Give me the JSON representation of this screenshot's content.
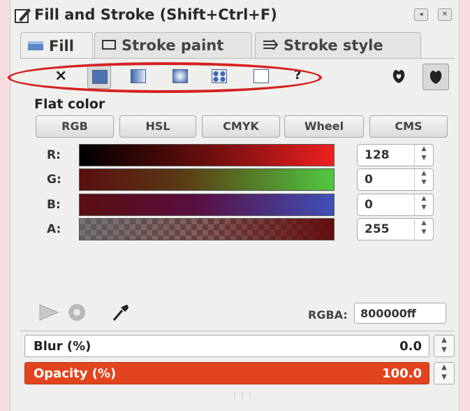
{
  "title": "Fill and Stroke (Shift+Ctrl+F)",
  "tabs": [
    {
      "label": "Fill"
    },
    {
      "label": "Stroke paint"
    },
    {
      "label": "Stroke style"
    }
  ],
  "paint_types": [
    {
      "name": "no-paint",
      "glyph": "×"
    },
    {
      "name": "flat-color",
      "selected": true
    },
    {
      "name": "linear-gradient"
    },
    {
      "name": "radial-gradient"
    },
    {
      "name": "pattern"
    },
    {
      "name": "swatch"
    },
    {
      "name": "unset",
      "glyph": "?"
    }
  ],
  "paint_mode_label": "Flat color",
  "color_modes": [
    "RGB",
    "HSL",
    "CMYK",
    "Wheel",
    "CMS"
  ],
  "channels": [
    {
      "label": "R:",
      "value": "128"
    },
    {
      "label": "G:",
      "value": "0"
    },
    {
      "label": "B:",
      "value": "0"
    },
    {
      "label": "A:",
      "value": "255"
    }
  ],
  "rgba": {
    "label": "RGBA:",
    "value": "800000ff"
  },
  "blur": {
    "label": "Blur (%)",
    "value": "0.0"
  },
  "opacity": {
    "label": "Opacity (%)",
    "value": "100.0"
  },
  "colors": {
    "highlight_ellipse": "#d42020",
    "opacity_bar": "#e2441f",
    "page_bg": "#f7dce0"
  }
}
